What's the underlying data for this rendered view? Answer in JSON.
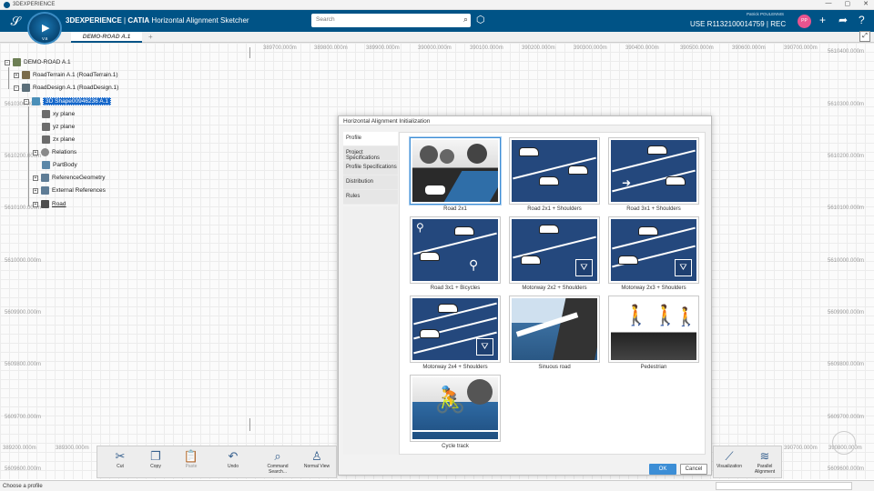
{
  "window": {
    "title": "3DEXPERIENCE",
    "controls": [
      "—",
      "▢",
      "✕"
    ]
  },
  "app": {
    "brand": "3DEXPERIENCE",
    "product": "CATIA",
    "app_name": "Horizontal Alignment Sketcher",
    "compass_version": "V.6"
  },
  "search": {
    "placeholder": "Search"
  },
  "user": {
    "name": "Patrick POULENNIS",
    "space": "USE R1132100014759 | REC"
  },
  "tabs": [
    {
      "label": "DEMO-ROAD A.1"
    }
  ],
  "ruler": {
    "x": [
      "389700.000m",
      "389800.000m",
      "389900.000m",
      "390000.000m",
      "390100.000m",
      "390200.000m",
      "390300.000m",
      "390400.000m",
      "390500.000m",
      "390600.000m",
      "390700.000m"
    ],
    "y_left": [
      "5610300.000m",
      "5610200.000m",
      "5610100.000m",
      "5610000.000m",
      "5609900.000m",
      "5609800.000m",
      "5609700.000m",
      "5609600.000m"
    ],
    "y_right": [
      "5610400.000m",
      "5610300.000m",
      "5610200.000m",
      "5610100.000m",
      "5610000.000m",
      "5609900.000m",
      "5609800.000m",
      "5609700.000m",
      "5609600.000m"
    ],
    "bottom_x": [
      "389200.000m",
      "389300.000m",
      "390700.000m",
      "390800.000m"
    ]
  },
  "tree": {
    "root": "DEMO-ROAD A.1",
    "items": [
      {
        "label": "RoadTerrain A.1 (RoadTerrain.1)"
      },
      {
        "label": "RoadDesign A.1 (RoadDesign.1)"
      },
      {
        "label": "3D Shape00946236 A.1"
      },
      {
        "label": "xy plane"
      },
      {
        "label": "yz plane"
      },
      {
        "label": "zx plane"
      },
      {
        "label": "Relations"
      },
      {
        "label": "PartBody"
      },
      {
        "label": "ReferenceGeometry"
      },
      {
        "label": "External References"
      },
      {
        "label": "Road"
      }
    ]
  },
  "dialog": {
    "title": "Horizontal Alignment Initialization",
    "nav": [
      {
        "label": "Profile"
      },
      {
        "label": "Project Specifications"
      },
      {
        "label": "Profile Specifications"
      },
      {
        "label": "Distribution"
      },
      {
        "label": "Rules"
      }
    ],
    "profiles": [
      {
        "label": "Road 2x1"
      },
      {
        "label": "Road 2x1 + Shoulders"
      },
      {
        "label": "Road 3x1 + Shoulders"
      },
      {
        "label": "Road 3x1 + Bicycles"
      },
      {
        "label": "Motorway 2x2 + Shoulders"
      },
      {
        "label": "Motorway 2x3 + Shoulders"
      },
      {
        "label": "Motorway 2x4 + Shoulders"
      },
      {
        "label": "Sinuous road"
      },
      {
        "label": "Pedestrian"
      },
      {
        "label": "Cycle track"
      }
    ],
    "ok_label": "OK",
    "cancel_label": "Cancel"
  },
  "toolbar": {
    "cut": "Cut",
    "copy": "Copy",
    "paste": "Paste",
    "undo": "Undo",
    "command_search": "Command Search...",
    "normal_view": "Normal View",
    "visualization": "Visualization",
    "parallel_alignment": "Parallel Alignment"
  },
  "status": {
    "message": "Choose a profile"
  },
  "colors": {
    "brand_blue": "#005386",
    "selection_blue": "#1466c9",
    "ok_blue": "#3c8ed6",
    "road_blue": "#24487d"
  }
}
